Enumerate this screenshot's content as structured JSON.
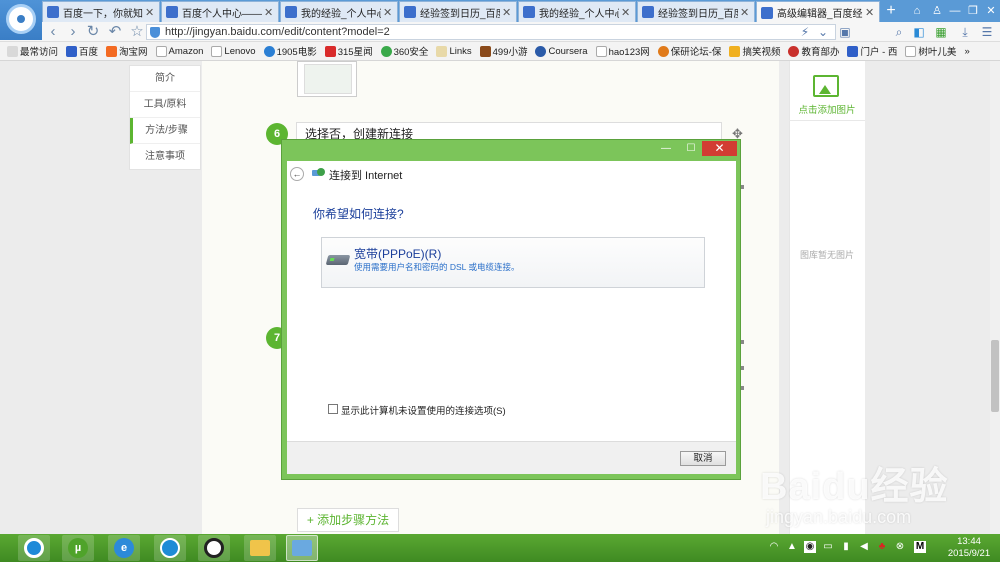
{
  "browser": {
    "tabs": [
      {
        "title": "百度一下，你就知道",
        "active": false
      },
      {
        "title": "百度个人中心——签",
        "active": false
      },
      {
        "title": "我的经验_个人中心",
        "active": false
      },
      {
        "title": "经验签到日历_百度",
        "active": false
      },
      {
        "title": "我的经验_个人中心",
        "active": false
      },
      {
        "title": "经验签到日历_百度",
        "active": false
      },
      {
        "title": "高级编辑器_百度经",
        "active": true
      }
    ],
    "url": "http://jingyan.baidu.com/edit/content?model=2",
    "bookmarks": [
      "最常访问",
      "百度",
      "淘宝网",
      "Amazon",
      "Lenovo",
      "1905电影",
      "315星闻",
      "360安全",
      "Links",
      "499小游",
      "Coursera",
      "hao123网",
      "保研论坛-保",
      "搞笑视频",
      "教育部办",
      "门户 - 西",
      "树叶儿美"
    ]
  },
  "page": {
    "nav_items": [
      "简介",
      "工具/原料",
      "方法/步骤",
      "注意事项"
    ],
    "active_nav": "方法/步骤",
    "step6": {
      "number": "6",
      "text": "选择否，创建新连接"
    },
    "step7": {
      "number": "7"
    },
    "add_image_label": "点击添加图片",
    "no_image_text": "图库暂无图片",
    "add_step_label": "+ 添加步骤方法",
    "watermark": {
      "brand": "Baidu经验",
      "domain": "jingyan.baidu.com"
    }
  },
  "dialog": {
    "title": "连接到 Internet",
    "question": "你希望如何连接?",
    "option": {
      "label": "宽带(PPPoE)(R)",
      "description": "使用需要用户名和密码的 DSL 或电缆连接。"
    },
    "checkbox_label": "显示此计算机未设置使用的连接选项(S)",
    "checkbox_checked": false,
    "cancel_label": "取消",
    "close_glyph": "✕",
    "minimize_glyph": "—",
    "maximize_glyph": "☐"
  },
  "taskbar": {
    "apps": [
      "qq-player-icon",
      "utorrent-icon",
      "ie-icon",
      "sogou-browser-icon",
      "panda-app-icon",
      "file-explorer-icon",
      "network-settings-icon"
    ],
    "clock_time": "13:44",
    "clock_date": "2015/9/21"
  },
  "colors": {
    "accent_green": "#5cb531",
    "dialog_border": "#7cc55a",
    "close_red": "#d23c33",
    "link_blue": "#1a3e9a"
  }
}
